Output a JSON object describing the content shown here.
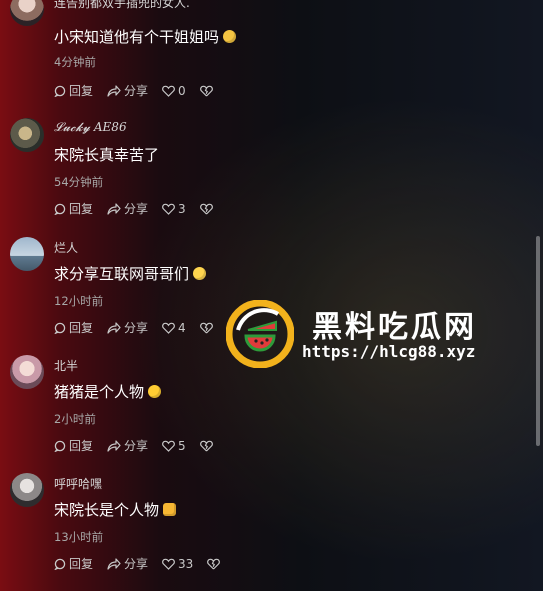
{
  "comments": [
    {
      "username": "连告别都双手插兜的女人.",
      "text": "小宋知道他有个干姐姐吗",
      "emoji": "smirk-emoji",
      "time": "4分钟前",
      "reply_label": "回复",
      "share_label": "分享",
      "likes": "0"
    },
    {
      "username": "𝓛𝓾𝓬𝓴𝔂 AE86",
      "text": "宋院长真幸苦了",
      "emoji": "",
      "time": "54分钟前",
      "reply_label": "回复",
      "share_label": "分享",
      "likes": "3"
    },
    {
      "username": "烂人",
      "text": "求分享互联网哥哥们",
      "emoji": "grin-sweat-emoji",
      "time": "12小时前",
      "reply_label": "回复",
      "share_label": "分享",
      "likes": "4"
    },
    {
      "username": "北半",
      "text": "猪猪是个人物",
      "emoji": "starstruck-emoji",
      "time": "2小时前",
      "reply_label": "回复",
      "share_label": "分享",
      "likes": "5"
    },
    {
      "username": "呼呼哈嘿",
      "text": "宋院长是个人物",
      "emoji": "thumbs-up-emoji",
      "time": "13小时前",
      "reply_label": "回复",
      "share_label": "分享",
      "likes": "33"
    }
  ],
  "watermark": {
    "title": "黑料吃瓜网",
    "url": "https://hlcg88.xyz"
  },
  "colors": {
    "accent_watermark": "#f2b21c",
    "watermelon_red": "#e23b3b",
    "watermelon_green": "#2e9b3a"
  }
}
